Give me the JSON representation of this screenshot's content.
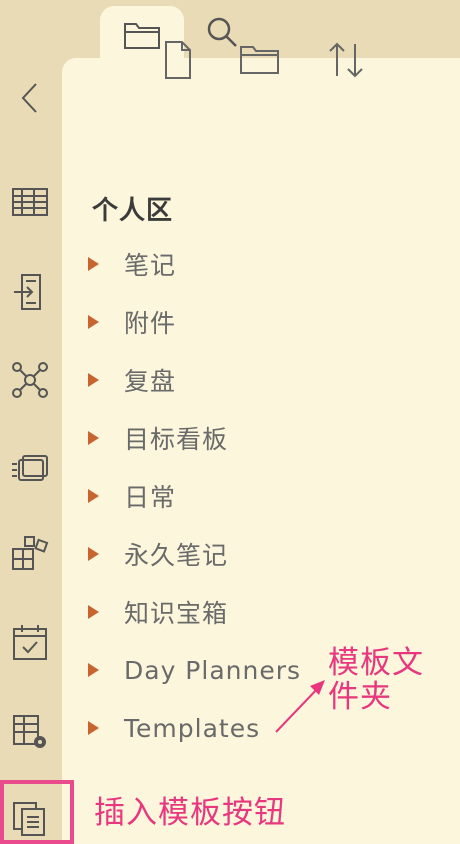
{
  "top_tabs": [
    {
      "icon": "folder-icon",
      "active": true
    },
    {
      "icon": "search-icon",
      "active": false
    }
  ],
  "left_rail": [
    {
      "icon": "chevron-left-icon"
    },
    {
      "icon": "table-icon"
    },
    {
      "icon": "import-document-icon"
    },
    {
      "icon": "graph-network-icon"
    },
    {
      "icon": "cards-icon"
    },
    {
      "icon": "blocks-icon"
    },
    {
      "icon": "calendar-check-icon"
    },
    {
      "icon": "table-settings-icon"
    },
    {
      "icon": "insert-template-icon"
    }
  ],
  "toolbar": [
    {
      "icon": "new-file-icon"
    },
    {
      "icon": "new-folder-icon"
    },
    {
      "icon": "sort-icon"
    }
  ],
  "section": {
    "title": "个人区"
  },
  "tree": [
    {
      "label": "笔记"
    },
    {
      "label": "附件"
    },
    {
      "label": "复盘"
    },
    {
      "label": "目标看板"
    },
    {
      "label": "日常"
    },
    {
      "label": "永久笔记"
    },
    {
      "label": "知识宝箱"
    },
    {
      "label": "Day Planners"
    },
    {
      "label": "Templates"
    }
  ],
  "annotations": {
    "template_folder_line1": "模板文",
    "template_folder_line2": "件夹",
    "insert_template_button": "插入模板按钮"
  },
  "colors": {
    "accent": "#c8642f",
    "annotation": "#e8377e",
    "panel": "#fbf6dc",
    "sidebar": "#e8dbb5"
  }
}
